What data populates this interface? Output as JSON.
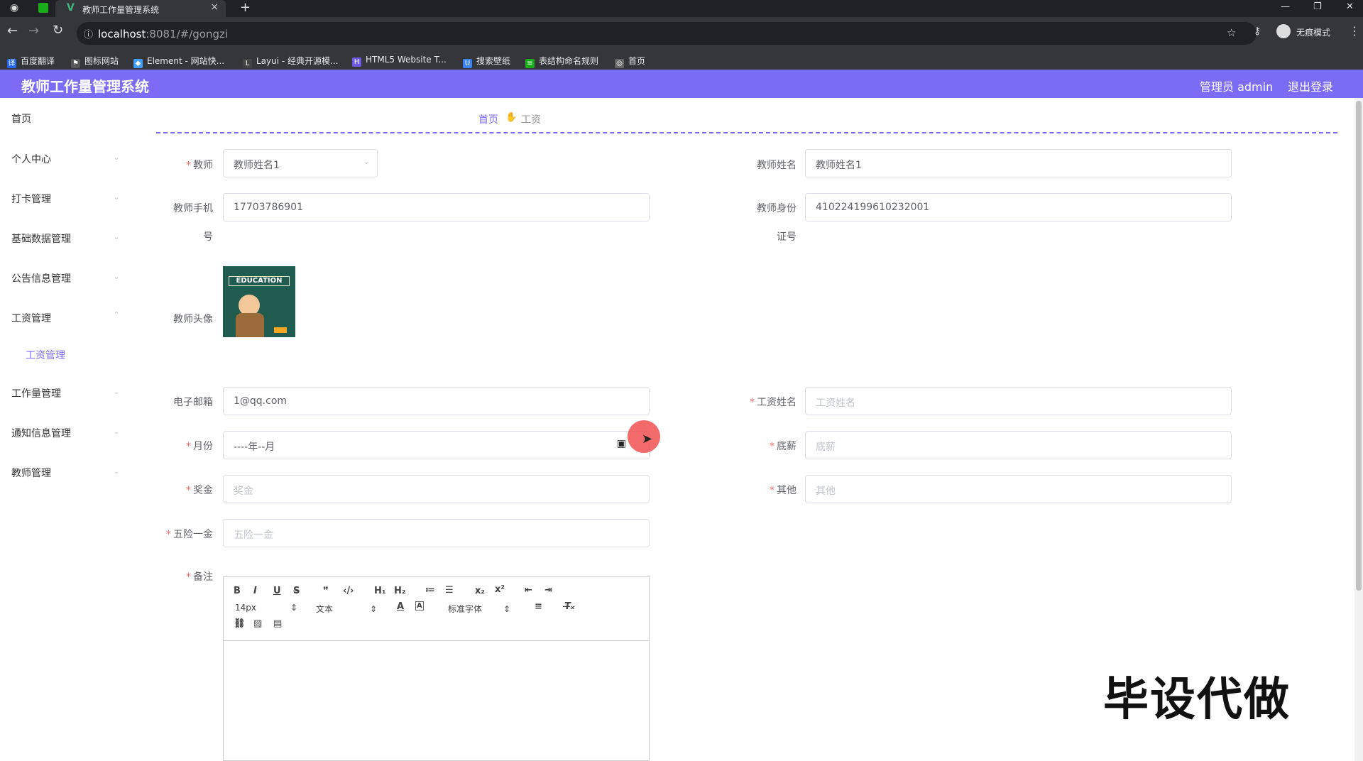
{
  "browser": {
    "tab_title": "教师工作量管理系统",
    "tab_close": "×",
    "new_tab": "+",
    "url_host": "localhost",
    "url_rest": ":8081/#/gongzi",
    "incognito": "无痕模式",
    "bookmarks": [
      "百度翻译",
      "图标网站",
      "Element - 网站快...",
      "Layui - 经典开源模...",
      "HTML5 Website T...",
      "搜索壁纸",
      "表结构命名规则",
      "首页"
    ]
  },
  "header": {
    "title": "教师工作量管理系统",
    "admin_label": "管理员 admin",
    "logout_label": "退出登录"
  },
  "sidebar": {
    "items": [
      "首页",
      "个人中心",
      "打卡管理",
      "基础数据管理",
      "公告信息管理",
      "工资管理",
      "工作量管理",
      "通知信息管理",
      "教师管理"
    ],
    "sub_item": "工资管理"
  },
  "breadcrumb": {
    "home": "首页",
    "current": "工资"
  },
  "form": {
    "teacher_label": "教师",
    "teacher_value": "教师姓名1",
    "teacher_name_label": "教师姓名",
    "teacher_name_value": "教师姓名1",
    "phone_label_1": "教师手机",
    "phone_label_2": "号",
    "phone_value": "17703786901",
    "id_label_1": "教师身份",
    "id_label_2": "证号",
    "id_value": "410224199610232001",
    "avatar_label": "教师头像",
    "avatar_text": "EDUCATION",
    "email_label": "电子邮箱",
    "email_value": "1@qq.com",
    "salary_name_label": "工资姓名",
    "salary_name_placeholder": "工资姓名",
    "month_label": "月份",
    "month_value": "----年--月",
    "base_label": "底薪",
    "base_placeholder": "底薪",
    "bonus_label": "奖金",
    "bonus_placeholder": "奖金",
    "other_label": "其他",
    "other_placeholder": "其他",
    "insurance_label": "五险一金",
    "insurance_placeholder": "五险一金",
    "remark_label": "备注",
    "editor_font_size": "14px",
    "editor_text_type": "文本",
    "editor_font_family": "标准字体"
  },
  "watermark": "毕设代做",
  "colors": {
    "primary": "#7b6cf6",
    "required": "#f56c6c"
  }
}
